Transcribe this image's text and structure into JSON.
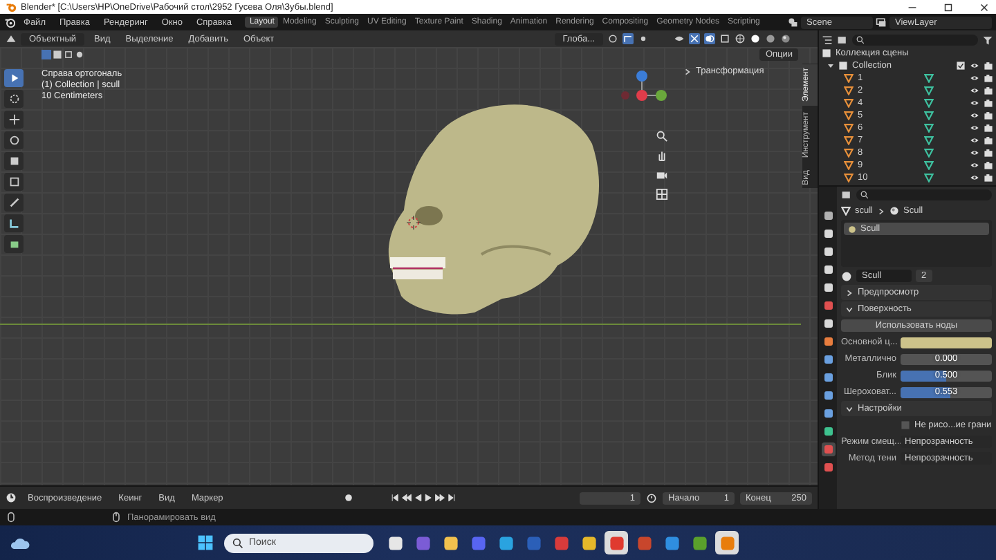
{
  "window": {
    "title": "Blender* [C:\\Users\\HP\\OneDrive\\Рабочий стол\\2952 Гусева Оля\\Зубы.blend]"
  },
  "menu": [
    "Файл",
    "Правка",
    "Рендеринг",
    "Окно",
    "Справка"
  ],
  "workspaces": [
    {
      "label": "Layout",
      "selected": true
    },
    {
      "label": "Modeling",
      "selected": false
    },
    {
      "label": "Sculpting",
      "selected": false
    },
    {
      "label": "UV Editing",
      "selected": false
    },
    {
      "label": "Texture Paint",
      "selected": false
    },
    {
      "label": "Shading",
      "selected": false
    },
    {
      "label": "Animation",
      "selected": false
    },
    {
      "label": "Rendering",
      "selected": false
    },
    {
      "label": "Compositing",
      "selected": false
    },
    {
      "label": "Geometry Nodes",
      "selected": false
    },
    {
      "label": "Scripting",
      "selected": false
    }
  ],
  "scene": "Scene",
  "view_layer": "ViewLayer",
  "viewport": {
    "mode": "Объектный",
    "menus": [
      "Вид",
      "Выделение",
      "Добавить",
      "Объект"
    ],
    "orientation": "Глоба...",
    "options": "Опции",
    "tools": [
      {
        "selected": true
      },
      {
        "selected": false
      },
      {
        "selected": false
      },
      {
        "selected": false
      },
      {
        "selected": false
      },
      {
        "selected": false
      },
      {
        "selected": false
      },
      {
        "selected": false
      },
      {
        "selected": false
      }
    ],
    "overlay": [
      "Справа ортогональ",
      "(1) Collection | scull",
      "10 Centimeters"
    ],
    "sidebar_panel": "Трансформация",
    "sidebar_tabs": [
      {
        "label": "Элемент",
        "selected": true
      },
      {
        "label": "Инструмент",
        "selected": false
      },
      {
        "label": "Вид",
        "selected": false
      }
    ]
  },
  "outliner": {
    "root": "Коллекция сцены",
    "items": [
      {
        "label": "Collection",
        "expanded": true,
        "included": true,
        "children": [
          {
            "label": "1"
          },
          {
            "label": "2"
          },
          {
            "label": "4"
          },
          {
            "label": "5"
          },
          {
            "label": "6"
          },
          {
            "label": "7"
          },
          {
            "label": "8"
          },
          {
            "label": "9"
          },
          {
            "label": "10"
          }
        ]
      }
    ]
  },
  "properties": {
    "tabs": [
      {
        "color": "#b0b0b0",
        "selected": false
      },
      {
        "color": "#d9d9d9",
        "selected": false
      },
      {
        "color": "#d9d9d9",
        "selected": false
      },
      {
        "color": "#d9d9d9",
        "selected": false
      },
      {
        "color": "#d9d9d9",
        "selected": false
      },
      {
        "color": "#e05050",
        "selected": false
      },
      {
        "color": "#d9d9d9",
        "selected": false
      },
      {
        "color": "#e87d3e",
        "selected": false
      },
      {
        "color": "#6aa0e0",
        "selected": false
      },
      {
        "color": "#6aa0e0",
        "selected": false
      },
      {
        "color": "#6aa0e0",
        "selected": false
      },
      {
        "color": "#6aa0e0",
        "selected": false
      },
      {
        "color": "#3ec28f",
        "selected": false
      },
      {
        "color": "#e05050",
        "selected": true
      },
      {
        "color": "#e05050",
        "selected": false
      }
    ],
    "breadcrumb": [
      "scull",
      "Scull"
    ],
    "slots": [
      {
        "label": "Scull",
        "selected": true
      }
    ],
    "material": {
      "name": "Scull",
      "users": "2"
    },
    "sections": [
      {
        "title": "Предпросмотр",
        "expanded": false
      },
      {
        "title": "Поверхность",
        "expanded": true,
        "rows": [
          {
            "kind": "button",
            "label": "Использовать ноды"
          },
          {
            "kind": "color",
            "label": "Основной ц...",
            "color": "#cdc38a"
          },
          {
            "kind": "slider",
            "label": "Металлично",
            "value": "0.000",
            "level": 0
          },
          {
            "kind": "slider",
            "label": "Блик",
            "value": "0.500",
            "level": 0.5
          },
          {
            "kind": "slider",
            "label": "Шероховат...",
            "value": "0.553",
            "level": 0.553
          }
        ]
      },
      {
        "title": "Настройки",
        "expanded": true,
        "rows": [
          {
            "kind": "checkbox",
            "label": "Не рисо...ие грани",
            "checked": false
          },
          {
            "kind": "dropdown",
            "label": "Режим смещ...",
            "value": "Непрозрачность"
          },
          {
            "kind": "dropdown",
            "label": "Метод тени",
            "value": "Непрозрачность"
          }
        ]
      }
    ]
  },
  "timeline": {
    "menus": [
      "Воспроизведение",
      "Кеинг",
      "Вид",
      "Маркер"
    ],
    "current_frame": "1",
    "start_label": "Начало",
    "start": "1",
    "end_label": "Конец",
    "end": "250"
  },
  "status_bar": {
    "hint": "Панорамировать вид"
  },
  "taskbar": {
    "search_placeholder": "Поиск",
    "apps": [
      {
        "color": "#e6e6e6",
        "selected": false
      },
      {
        "color": "#7b5cd6",
        "selected": false
      },
      {
        "color": "#f2c14e",
        "selected": false
      },
      {
        "color": "#5865f2",
        "selected": false
      },
      {
        "color": "#2aa3e0",
        "selected": false
      },
      {
        "color": "#2b5fb8",
        "selected": false
      },
      {
        "color": "#d83b3b",
        "selected": false
      },
      {
        "color": "#e5b82a",
        "selected": false
      },
      {
        "color": "#e03a2f",
        "selected": true
      },
      {
        "color": "#c8462c",
        "selected": false
      },
      {
        "color": "#2f8ee0",
        "selected": false
      },
      {
        "color": "#5aa02c",
        "selected": false
      },
      {
        "color": "#e87d0d",
        "selected": true
      }
    ]
  }
}
